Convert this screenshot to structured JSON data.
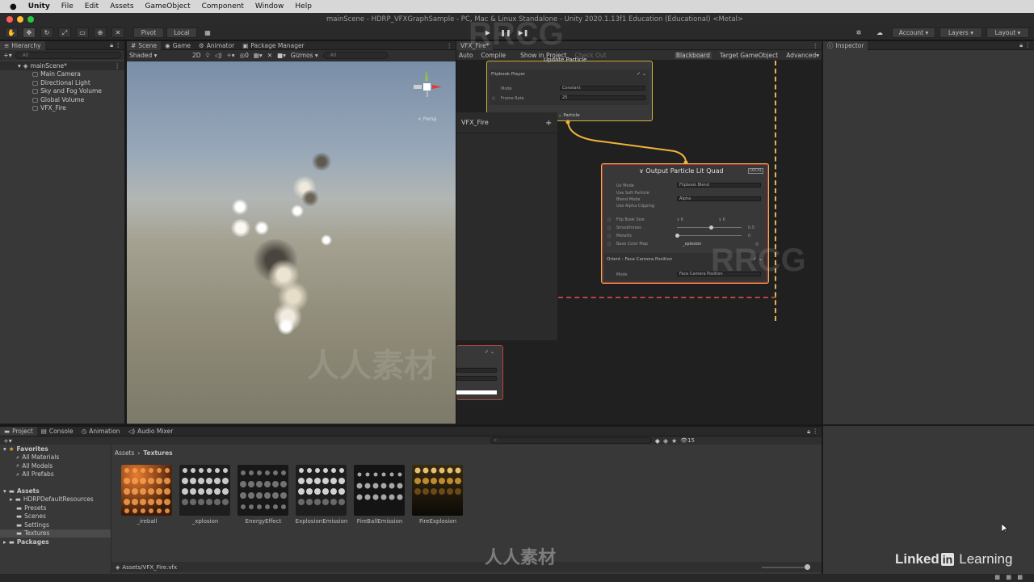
{
  "menubar": {
    "app": "Unity",
    "items": [
      "File",
      "Edit",
      "Assets",
      "GameObject",
      "Component",
      "Window",
      "Help"
    ]
  },
  "window_title": "mainScene - HDRP_VFXGraphSample - PC, Mac & Linux Standalone - Unity 2020.1.13f1 Education (Educational) <Metal>",
  "toolbar": {
    "pivot": "Pivot",
    "local": "Local",
    "account": "Account",
    "layers": "Layers",
    "layout": "Layout"
  },
  "hierarchy": {
    "tab": "Hierarchy",
    "search_placeholder": "All",
    "scene": "mainScene*",
    "items": [
      "Main Camera",
      "Directional Light",
      "Sky and Fog Volume",
      "Global Volume",
      "VFX_Fire"
    ]
  },
  "scene_tabs": [
    "Scene",
    "Game",
    "Animator",
    "Package Manager"
  ],
  "scene_toolbar": {
    "shading": "Shaded",
    "mode": "2D",
    "gizmos": "Gizmos",
    "search_placeholder": "All",
    "persp": "< Persp"
  },
  "vfx": {
    "tab": "VFX_Fire*",
    "toolbar": [
      "Auto",
      "Compile",
      "Show in Project",
      "Check Out"
    ],
    "toolbar_right": [
      "Blackboard",
      "Target GameObject",
      "Advanced"
    ],
    "update_title": "Update Particle",
    "flipbook_block": "Flipbook Player",
    "mode_label": "Mode",
    "mode_value": "Constant",
    "frame_rate_label": "Frame Rate",
    "frame_rate_value": "25",
    "particle_label": "Particle",
    "blackboard_title": "VFX_Fire",
    "output_title": "Output Particle Lit Quad",
    "output_badge": "LOCAL",
    "output_fields": [
      {
        "label": "Uv Mode",
        "value": "Flipbook Blend"
      },
      {
        "label": "Use Soft Particle",
        "value": ""
      },
      {
        "label": "Blend Mode",
        "value": "Alpha"
      },
      {
        "label": "Use Alpha Clipping",
        "value": ""
      }
    ],
    "flip_book_size_label": "Flip Book Size",
    "flip_x": "6",
    "flip_y": "6",
    "smoothness_label": "Smoothness",
    "smoothness_value": "0.5",
    "metallic_label": "Metallic",
    "metallic_value": "0",
    "base_color_map_label": "Base Color Map",
    "base_color_map_value": "_xplosion",
    "orient_block": "Orient : Face Camera Position",
    "orient_mode_label": "Mode",
    "orient_mode_value": "Face Camera Position"
  },
  "inspector": {
    "tab": "Inspector"
  },
  "bottom_tabs": [
    "Project",
    "Console",
    "Animation",
    "Audio Mixer"
  ],
  "project": {
    "favorites": "Favorites",
    "favorite_items": [
      "All Materials",
      "All Models",
      "All Prefabs"
    ],
    "assets": "Assets",
    "asset_folders": [
      "HDRPDefaultResources",
      "Presets",
      "Scenes",
      "Settings",
      "Textures"
    ],
    "packages": "Packages",
    "breadcrumb": [
      "Assets",
      "Textures"
    ],
    "hidden_count": "15",
    "thumbnails": [
      "_ireball",
      "_xplosion",
      "EnergyEffect",
      "ExplosionEmission",
      "FireBallEmission",
      "FireExplosion"
    ],
    "selected_path": "Assets/VFX_Fire.vfx"
  },
  "watermark": {
    "rrcg": "RRCG",
    "cn": "人人素材",
    "linkedin": "Linked",
    "linkedin_in": "in",
    "learning": "Learning"
  }
}
